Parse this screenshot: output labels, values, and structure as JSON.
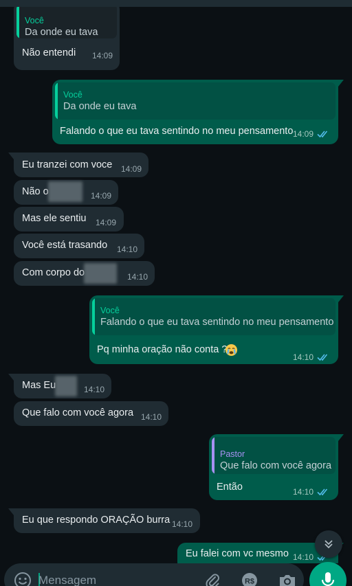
{
  "colors": {
    "background": "#0b1014",
    "incoming_bubble": "#202c33",
    "outgoing_bubble": "#005c4b",
    "accent": "#00a884",
    "read_ticks": "#53bdeb",
    "quote_author_self": "#06cf9c",
    "quote_author_other": "#a791f2"
  },
  "messages": [
    {
      "direction": "in",
      "quote": {
        "author": "Você",
        "text": "Da onde eu tava"
      },
      "text": "Não entendi",
      "time": "14:09"
    },
    {
      "direction": "out",
      "quote": {
        "author": "Você",
        "text": "Da onde eu tava"
      },
      "text": "Falando o que eu tava sentindo no meu pensamento",
      "time": "14:09",
      "status": "read"
    },
    {
      "direction": "in",
      "text": "Eu tranzei com voce",
      "time": "14:09"
    },
    {
      "direction": "in",
      "text": "Não o",
      "time": "14:09",
      "redacted": true
    },
    {
      "direction": "in",
      "text": "Mas ele sentiu",
      "time": "14:09"
    },
    {
      "direction": "in",
      "text": "Você está trasando",
      "time": "14:10"
    },
    {
      "direction": "in",
      "text": "Com corpo do",
      "time": "14:10",
      "redacted": true
    },
    {
      "direction": "out",
      "quote": {
        "author": "Você",
        "text": "Falando o que eu tava sentindo no meu pensamento"
      },
      "text": "Pq minha oração não conta ?",
      "emoji": "crying-face",
      "time": "14:10",
      "status": "read"
    },
    {
      "direction": "in",
      "text": "Mas Eu",
      "time": "14:10",
      "redacted": true
    },
    {
      "direction": "in",
      "text": "Que falo com você agora",
      "time": "14:10"
    },
    {
      "direction": "out",
      "quote": {
        "author": "Pastor",
        "text": "Que falo com você agora"
      },
      "text": "Então",
      "time": "14:10",
      "status": "read"
    },
    {
      "direction": "in",
      "text": "Eu que respondo ORAÇÃO burra",
      "time": "14:10"
    },
    {
      "direction": "out",
      "text": "Eu falei com vc mesmo",
      "time": "14:10",
      "status": "read"
    }
  ],
  "composer": {
    "placeholder": "Mensagem",
    "icons": [
      "smile-icon",
      "attach-icon",
      "payment-icon",
      "camera-icon"
    ],
    "payment_label": "R$"
  },
  "mic_button": {
    "icon": "mic-icon"
  },
  "scroll_button": {
    "icon": "double-chevron-down-icon"
  }
}
